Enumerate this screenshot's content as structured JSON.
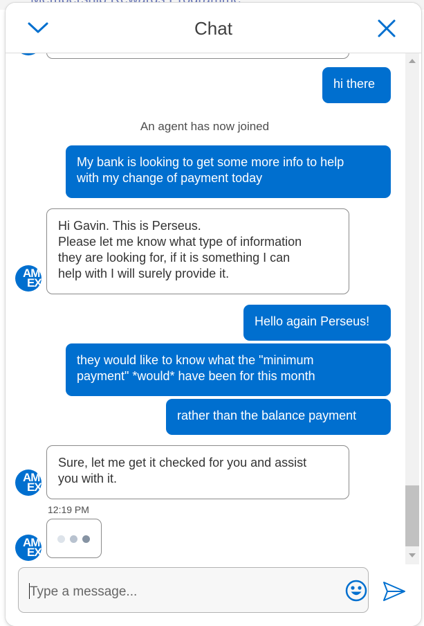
{
  "background": {
    "page_heading": "Membership Rewards Programme"
  },
  "header": {
    "title": "Chat",
    "minimize_icon": "chevron-down-icon",
    "close_icon": "close-icon"
  },
  "avatar": {
    "line1": "AM",
    "line2": "EX"
  },
  "messages": [
    {
      "type": "user",
      "text": "hi there"
    },
    {
      "type": "system",
      "text": "An agent has now joined"
    },
    {
      "type": "user",
      "text": "My bank is looking to get some more info to help\nwith my change of payment today"
    },
    {
      "type": "agent",
      "text": "Hi Gavin. This is Perseus.\nPlease let me know what type of information\nthey are looking for, if it is something I can\nhelp with I will surely provide it."
    },
    {
      "type": "user",
      "text": "Hello again Perseus!"
    },
    {
      "type": "user",
      "text": "they would like to know what the \"minimum\npayment\" *would* have been for this month"
    },
    {
      "type": "user",
      "text": "rather than the balance payment"
    },
    {
      "type": "agent",
      "text": "Sure, let me get it checked for you and assist\nyou with it.",
      "timestamp": "12:19 PM"
    }
  ],
  "typing_indicator": {
    "dot_colors": [
      "#dde3ea",
      "#b8c2cf",
      "#8693a3"
    ]
  },
  "composer": {
    "placeholder": "Type a message...",
    "emoji_icon": "emoji-icon",
    "send_icon": "send-icon"
  },
  "colors": {
    "accent": "#006fcf",
    "agent_border": "#8a8a8a",
    "header_text": "#3f3f3f"
  }
}
